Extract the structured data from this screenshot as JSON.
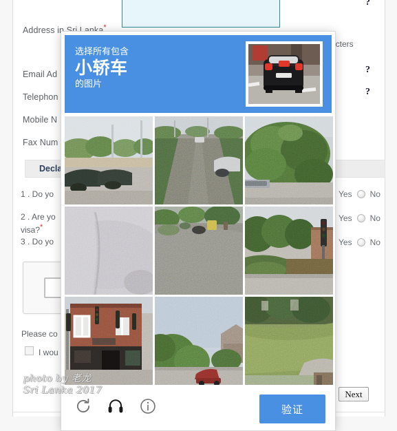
{
  "form": {
    "labels": {
      "address": "Address in Sri Lanka",
      "email": "Email Ad",
      "telephone": "Telephon",
      "mobile": "Mobile N",
      "fax": "Fax Num",
      "required_mark": "*"
    },
    "char_note": "racters",
    "help_marks": [
      "?",
      "?",
      "?",
      "?"
    ],
    "declaration_header": "Decla",
    "questions": [
      "1 . Do yo",
      "2 . Are yo",
      "visa?",
      "3 . Do yo"
    ],
    "answers": {
      "yes_label": "Yes",
      "no_label": "No",
      "rows": [
        {
          "yes": "Yes",
          "no": "No"
        },
        {
          "yes": "Yes",
          "no": "No"
        },
        {
          "yes": "Yes",
          "no": "No"
        }
      ]
    },
    "please_text": "Please co",
    "subscribe_label": "I wou",
    "next_button": "Next"
  },
  "watermark": {
    "line1": "photo by 老龙",
    "line2": "Sri Lanka 2017"
  },
  "captcha": {
    "prompt_line1": "选择所有包含",
    "prompt_line2": "小轿车",
    "prompt_line3": "的图片",
    "example_alt": "black-car-rear-view",
    "verify_button": "验证",
    "icons": {
      "reload": "reload-icon",
      "audio": "headphone-icon",
      "info": "info-icon"
    },
    "tiles": [
      {
        "id": "tile-1",
        "alt": "parking lot with trees and dark cars"
      },
      {
        "id": "tile-2",
        "alt": "road with hedge and silver car"
      },
      {
        "id": "tile-3",
        "alt": "large green tree beside road"
      },
      {
        "id": "tile-4",
        "alt": "blurred pale road surface"
      },
      {
        "id": "tile-5",
        "alt": "grey street with roadside shrubs"
      },
      {
        "id": "tile-6",
        "alt": "traffic light and brick wall"
      },
      {
        "id": "tile-7",
        "alt": "brick building with traffic lights"
      },
      {
        "id": "tile-8",
        "alt": "tree and red car under blue sky"
      },
      {
        "id": "tile-9",
        "alt": "green lawn and hedge"
      }
    ]
  },
  "colors": {
    "captcha_blue": "#4a90e2",
    "declaration_bg": "#ededed",
    "address_field_bg": "#e6f6fb",
    "address_field_border": "#2d8f96",
    "required_red": "#d0342c"
  }
}
